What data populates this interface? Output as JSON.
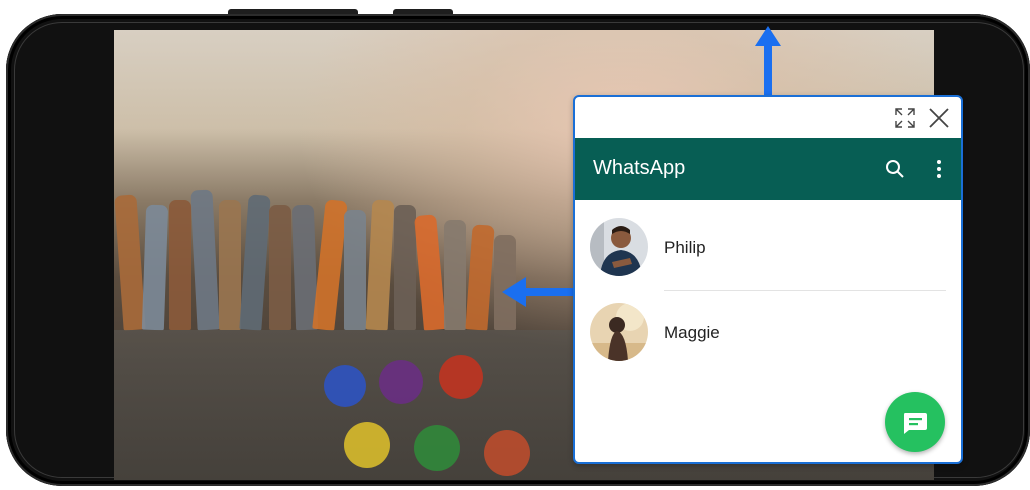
{
  "app": {
    "title": "WhatsApp"
  },
  "popup_controls": {
    "expand_icon": "expand-icon",
    "close_icon": "close-icon"
  },
  "toolbar": {
    "search_icon": "search-icon",
    "menu_icon": "more-vert-icon"
  },
  "chats": [
    {
      "name": "Philip",
      "avatar": "avatar-philip"
    },
    {
      "name": "Maggie",
      "avatar": "avatar-maggie"
    }
  ],
  "fab": {
    "icon": "new-message-icon"
  },
  "colors": {
    "appbar": "#075e54",
    "fab": "#25c160",
    "window_border": "#1a6fd6",
    "arrows": "#1a6ff0"
  }
}
